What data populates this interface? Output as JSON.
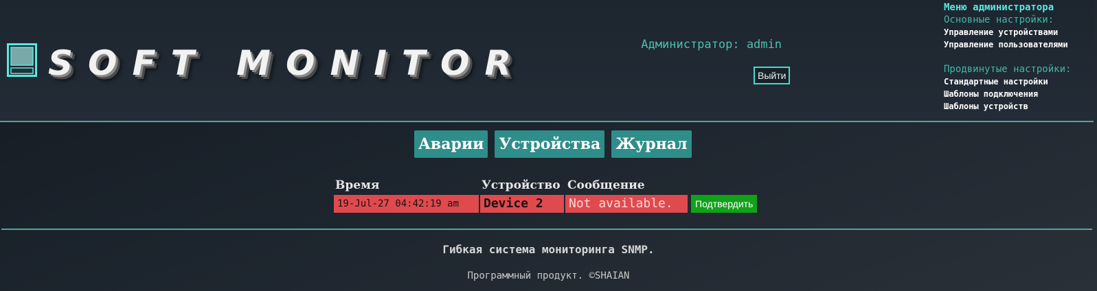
{
  "header": {
    "logo_text": "SOFT MONITOR",
    "admin_label": "Администратор: admin",
    "logout_label": "Выйти"
  },
  "admin_menu": {
    "title": "Меню администратора",
    "basic_title": "Основные настройки:",
    "basic_items": [
      "Управление устройствами",
      "Управление пользователями"
    ],
    "advanced_title": "Продвинутые настройки:",
    "advanced_items": [
      "Стандартные настройки",
      "Шаблоны подключения",
      "Шаблоны устройств"
    ]
  },
  "tabs": [
    "Аварии",
    "Устройства",
    "Журнал"
  ],
  "alarms": {
    "headers": {
      "time": "Время",
      "device": "Устройство",
      "message": "Сообщение"
    },
    "rows": [
      {
        "time": "19-Jul-27 04:42:19 am",
        "device": "Device 2",
        "message": "Not available.",
        "action": "Подтвердить"
      }
    ]
  },
  "footer": {
    "tagline": "Гибкая система мониторинга SNMP.",
    "copyright": "Программный продукт. ©SHAIAN"
  },
  "colors": {
    "accent": "#4fa6a6",
    "tab_bg": "#2f8d8a",
    "alarm_bg": "#df4a4e",
    "confirm_bg": "#12a11b",
    "admin_text": "#4fbfae"
  }
}
